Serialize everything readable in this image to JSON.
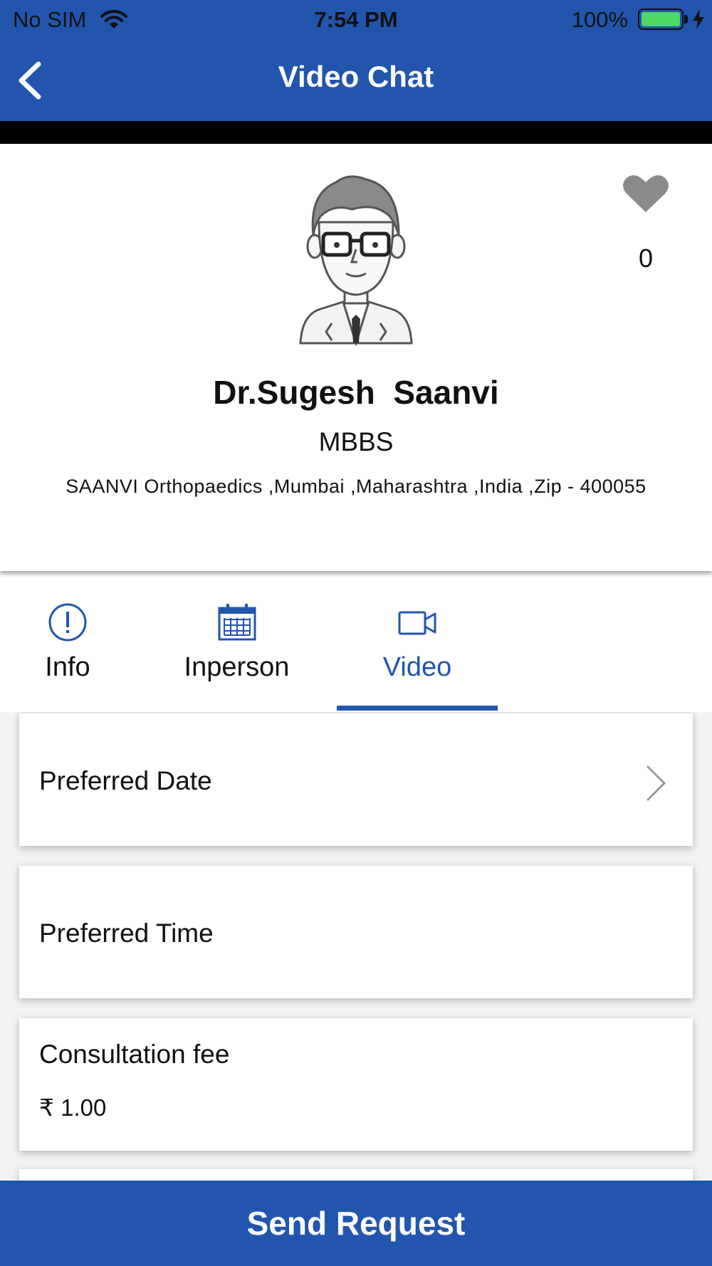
{
  "status_bar": {
    "carrier": "No SIM",
    "time": "7:54 PM",
    "battery_percent": "100%",
    "battery_level": 1.0,
    "icons": [
      "wifi-icon",
      "battery-icon",
      "charging-bolt-icon"
    ]
  },
  "nav": {
    "title": "Video Chat",
    "back_icon": "chevron-left-icon"
  },
  "doctor": {
    "name": "Dr.Sugesh  Saanvi",
    "degree": "MBBS",
    "address": "SAANVI Orthopaedics ,Mumbai ,Maharashtra ,India ,Zip - 400055",
    "avatar_icon": "doctor-avatar-icon",
    "like_icon": "heart-icon",
    "likes": "0"
  },
  "tabs": [
    {
      "label": "Info",
      "icon": "info-circle-icon",
      "active": false
    },
    {
      "label": "Inperson",
      "icon": "calendar-icon",
      "active": false
    },
    {
      "label": "Video",
      "icon": "video-camera-icon",
      "active": true
    }
  ],
  "form": {
    "preferred_date_label": "Preferred Date",
    "preferred_time_label": "Preferred Time",
    "fee_label": "Consultation fee",
    "fee_value": "₹ 1.00"
  },
  "actions": {
    "send_request": "Send Request"
  },
  "colors": {
    "primary": "#2255ad",
    "battery_green": "#4cd964",
    "heart_gray": "#8a8a8a"
  }
}
